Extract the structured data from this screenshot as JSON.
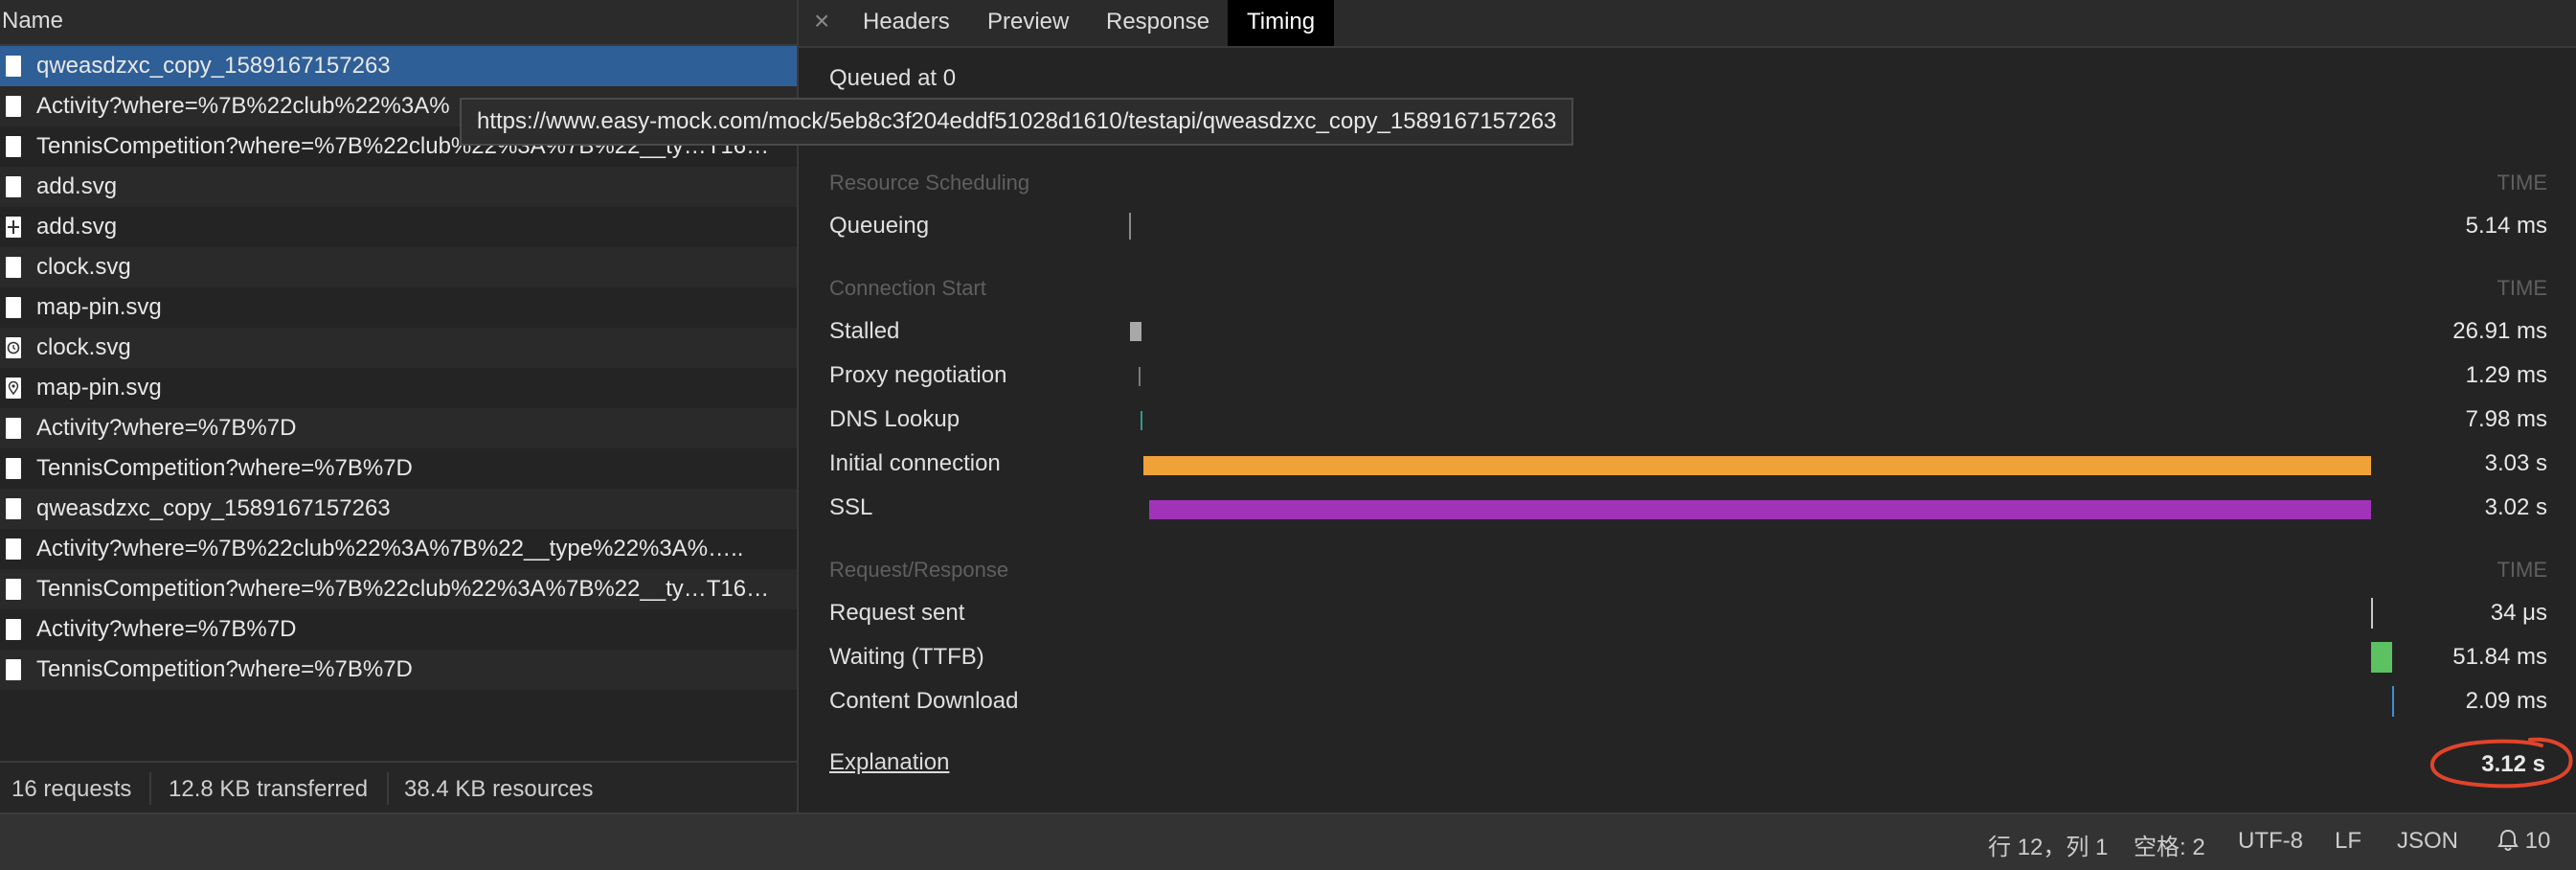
{
  "left": {
    "header": "Name",
    "rows": [
      {
        "name": "qweasdzxc_copy_1589167157263",
        "icon": "file-icon",
        "selected": true
      },
      {
        "name": "Activity?where=%7B%22club%22%3A%",
        "icon": "file-icon"
      },
      {
        "name": "TennisCompetition?where=%7B%22club%22%3A%7B%22__ty…T16…",
        "icon": "file-icon"
      },
      {
        "name": "add.svg",
        "icon": "file-icon"
      },
      {
        "name": "add.svg",
        "icon": "plus-file-icon"
      },
      {
        "name": "clock.svg",
        "icon": "file-icon"
      },
      {
        "name": "map-pin.svg",
        "icon": "file-icon"
      },
      {
        "name": "clock.svg",
        "icon": "clock-file-icon"
      },
      {
        "name": "map-pin.svg",
        "icon": "pin-file-icon"
      },
      {
        "name": "Activity?where=%7B%7D",
        "icon": "file-icon"
      },
      {
        "name": "TennisCompetition?where=%7B%7D",
        "icon": "file-icon"
      },
      {
        "name": "qweasdzxc_copy_1589167157263",
        "icon": "file-icon"
      },
      {
        "name": "Activity?where=%7B%22club%22%3A%7B%22__type%22%3A%…..",
        "icon": "file-icon"
      },
      {
        "name": "TennisCompetition?where=%7B%22club%22%3A%7B%22__ty…T16…",
        "icon": "file-icon"
      },
      {
        "name": "Activity?where=%7B%7D",
        "icon": "file-icon"
      },
      {
        "name": "TennisCompetition?where=%7B%7D",
        "icon": "file-icon"
      }
    ],
    "tooltip": "https://www.easy-mock.com/mock/5eb8c3f204eddf51028d1610/testapi/qweasdzxc_copy_1589167157263",
    "summary": {
      "requests": "16 requests",
      "transferred": "12.8 KB transferred",
      "resources": "38.4 KB resources"
    }
  },
  "tabs": {
    "close": "×",
    "headers": "Headers",
    "preview": "Preview",
    "response": "Response",
    "timing": "Timing",
    "active": "Timing"
  },
  "timing": {
    "queued": "Queued at 0",
    "time_header": "TIME",
    "sections": [
      {
        "title": "Resource Scheduling",
        "rows": [
          {
            "label": "Queueing",
            "value": "5.14 ms",
            "color": "#8a8a8a"
          }
        ]
      },
      {
        "title": "Connection Start",
        "rows": [
          {
            "label": "Stalled",
            "value": "26.91 ms",
            "color": "#a8a8a8"
          },
          {
            "label": "Proxy negotiation",
            "value": "1.29 ms",
            "color": "#7a7a7a"
          },
          {
            "label": "DNS Lookup",
            "value": "7.98 ms",
            "color": "#2a9d8f"
          },
          {
            "label": "Initial connection",
            "value": "3.03 s",
            "color": "#f0a238"
          },
          {
            "label": "SSL",
            "value": "3.02 s",
            "color": "#a033b8"
          }
        ]
      },
      {
        "title": "Request/Response",
        "rows": [
          {
            "label": "Request sent",
            "value": "34 μs",
            "color": "#c8c8c8"
          },
          {
            "label": "Waiting (TTFB)",
            "value": "51.84 ms",
            "color": "#5cc160"
          },
          {
            "label": "Content Download",
            "value": "2.09 ms",
            "color": "#3b8fd9"
          }
        ]
      }
    ],
    "explanation": "Explanation",
    "total": "3.12 s",
    "annotation_color": "#e0442a"
  },
  "statusbar": {
    "position": "行 12，列 1",
    "spaces": "空格: 2",
    "encoding": "UTF-8",
    "eol": "LF",
    "language": "JSON",
    "notifications": "10"
  }
}
